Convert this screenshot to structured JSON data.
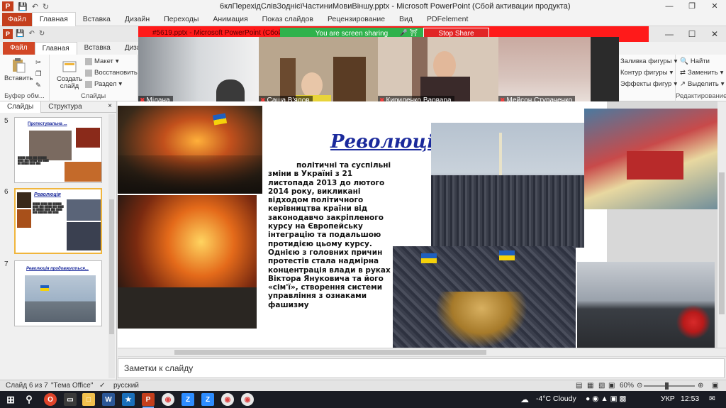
{
  "outer_window": {
    "title": "6клПерехідСлівЗоднієїЧастиниМовиВіншу.pptx  -  Microsoft PowerPoint (Сбой активации продукта)",
    "tabs": [
      "Файл",
      "Главная",
      "Вставка",
      "Дизайн",
      "Переходы",
      "Анимация",
      "Показ слайдов",
      "Рецензирование",
      "Вид",
      "PDFelement"
    ],
    "active_tab": "Главная"
  },
  "screen_share": {
    "inner_title": "#5619.pptx - Microsoft PowerPoint (Сбой акт...",
    "status": "You are screen sharing",
    "stop_label": "Stop Share"
  },
  "inner_window": {
    "tabs": [
      "Файл",
      "Главная",
      "Вставка",
      "Дизайн"
    ],
    "active_tab": "Главная"
  },
  "ribbon": {
    "paste_label": "Вставить",
    "clipboard_label": "Буфер обм...",
    "create_slide_label": "Создать слайд",
    "layout_label": "Макет",
    "reset_label": "Восстановить",
    "section_label": "Раздел",
    "slides_group_label": "Слайды",
    "shape_fill_label": "Заливка фигуры",
    "shape_outline_label": "Контур фигуры",
    "shape_effects_label": "Эффекты фигур",
    "find_label": "Найти",
    "replace_label": "Заменить",
    "select_label": "Выделить",
    "editing_group_label": "Редактирование"
  },
  "participants": [
    {
      "name": "Мілана"
    },
    {
      "name": "Саша В'ялов"
    },
    {
      "name": "Кириленко Варвара"
    },
    {
      "name": "Мейсон Ступаченко"
    }
  ],
  "slides_pane": {
    "tabs": [
      "Слайды",
      "Структура"
    ],
    "close": "×",
    "slides": [
      {
        "number": "5",
        "title": "Протестувальна ...",
        "selected": false
      },
      {
        "number": "6",
        "title": "Революція",
        "selected": true
      },
      {
        "number": "7",
        "title": "Революція продовжується...",
        "selected": false
      }
    ]
  },
  "slide": {
    "title": "Революція г",
    "body": "політичні та суспільні зміни в Україні з 21 листопада 2013 до лютого 2014 року, викликані відходом політичного керівництва країни від законодавчо закріпленого курсу на Європейську інтеграцію та подальшою протидією цьому курсу. Однією з головних причин протестів стала надмірна концентрація влади в руках Віктора Януковича та його «сім'ї», створення системи управління з ознаками фашизму"
  },
  "notes_placeholder": "Заметки к слайду",
  "status_bar": {
    "slide_indicator": "Слайд 6 из 7",
    "theme": "\"Тема Office\"",
    "language": "русский",
    "zoom": "60%"
  },
  "taskbar": {
    "weather": "-4°C  Cloudy",
    "language": "УКР",
    "time": "12:53"
  },
  "colors": {
    "ppt_accent": "#c43e1c",
    "share_green": "#2fb24c",
    "stop_red": "#e12525",
    "title_blue": "#1b2a9c"
  }
}
